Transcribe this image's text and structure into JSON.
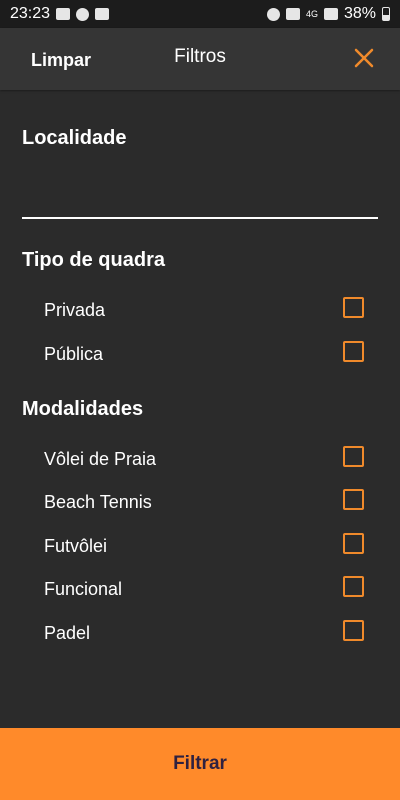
{
  "status_bar": {
    "time": "23:23",
    "network": "4G",
    "battery": "38%"
  },
  "header": {
    "clear_label": "Limpar",
    "title": "Filtros",
    "close_icon": "close-icon",
    "accent": "#f08a2b"
  },
  "sections": {
    "localidade": {
      "title": "Localidade",
      "value": ""
    },
    "tipo": {
      "title": "Tipo de quadra",
      "options": [
        {
          "label": "Privada",
          "checked": false
        },
        {
          "label": "Pública",
          "checked": false
        }
      ]
    },
    "modalidades": {
      "title": "Modalidades",
      "options": [
        {
          "label": "Vôlei de Praia",
          "checked": false
        },
        {
          "label": "Beach Tennis",
          "checked": false
        },
        {
          "label": "Futvôlei",
          "checked": false
        },
        {
          "label": "Funcional",
          "checked": false
        },
        {
          "label": "Padel",
          "checked": false
        }
      ]
    }
  },
  "footer": {
    "button_label": "Filtrar",
    "color": "#ff8a2a"
  }
}
